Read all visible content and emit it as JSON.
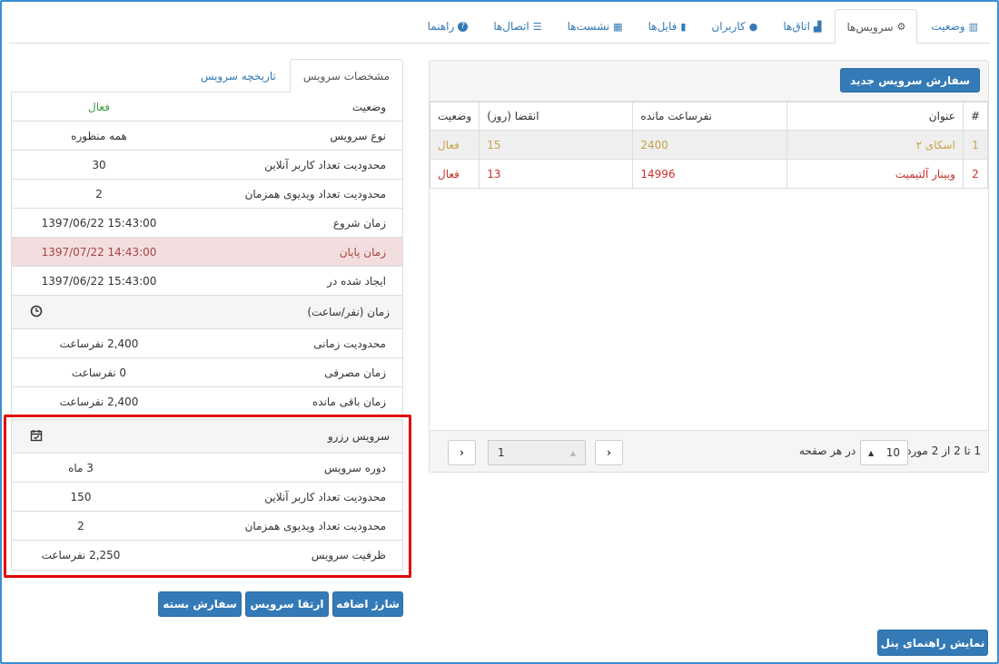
{
  "top_tabs": [
    {
      "label": "وضعیت",
      "icon": "chart-icon",
      "glyph": "📊"
    },
    {
      "label": "سرویس‌ها",
      "icon": "gear-icon",
      "glyph": "⚙"
    },
    {
      "label": "اتاق‌ها",
      "icon": "sitemap-icon",
      "glyph": "▣"
    },
    {
      "label": "کاربران",
      "icon": "user-icon",
      "glyph": "👤"
    },
    {
      "label": "فایل‌ها",
      "icon": "file-icon",
      "glyph": "▮"
    },
    {
      "label": "نشست‌ها",
      "icon": "grid-icon",
      "glyph": "▦"
    },
    {
      "label": "اتصال‌ها",
      "icon": "list-icon",
      "glyph": "☰"
    },
    {
      "label": "راهنما",
      "icon": "question-icon",
      "glyph": "?"
    }
  ],
  "detail": {
    "tab_specs": "مشخصات سرویس",
    "tab_history": "تاریخچه سرویس",
    "rows": [
      {
        "label": "وضعیت",
        "value": "فعال"
      },
      {
        "label": "نوع سرویس",
        "value": "همه منظوره"
      },
      {
        "label": "محدودیت تعداد کاربر آنلاین",
        "value": "30"
      },
      {
        "label": "محدودیت تعداد ویدیوی همزمان",
        "value": "2"
      },
      {
        "label": "زمان شروع",
        "value": "1397/06/22 15:43:00"
      },
      {
        "label": "زمان پایان",
        "value": "1397/07/22 14:43:00"
      },
      {
        "label": "ایجاد شده در",
        "value": "1397/06/22 15:43:00"
      }
    ],
    "time_section": {
      "title": "زمان (نفر/ساعت)",
      "icon": "clock-icon",
      "rows": [
        {
          "label": "محدودیت زمانی",
          "value": "2,400 نفرساعت"
        },
        {
          "label": "زمان مصرفی",
          "value": "0 نفرساعت"
        },
        {
          "label": "زمان باقی مانده",
          "value": "2,400 نفرساعت"
        }
      ]
    },
    "reserve_section": {
      "title": "سرویس رزرو",
      "icon": "calendar-check-icon",
      "rows": [
        {
          "label": "دوره سرویس",
          "value": "3 ماه"
        },
        {
          "label": "محدودیت تعداد کاربر آنلاین",
          "value": "150"
        },
        {
          "label": "محدودیت تعداد ویدیوی همزمان",
          "value": "2"
        },
        {
          "label": "ظرفیت سرویس",
          "value": "2,250 نفرساعت"
        }
      ]
    },
    "buttons": {
      "extra_charge": "شارژ اضافه",
      "upgrade": "ارتقا سرویس",
      "order_package": "سفارش بسته"
    }
  },
  "services": {
    "new_button": "سفارش سرویس جدید",
    "columns": [
      "#",
      "عنوان",
      "نفرساعت مانده",
      "انقضا (روز)",
      "وضعیت"
    ],
    "rows": [
      {
        "idx": "1",
        "title": "اسکای ۲",
        "remaining": "2400",
        "expiry": "15",
        "status": "فعال"
      },
      {
        "idx": "2",
        "title": "وبینار آلتیمیت",
        "remaining": "14996",
        "expiry": "13",
        "status": "فعال"
      }
    ],
    "pagination": {
      "info": "1 تا 2 از 2 مورد",
      "per_page_value": "10",
      "per_page_label": "در هر صفحه",
      "page_value": "1"
    }
  },
  "help_button": "نمایش راهنمای پنل"
}
